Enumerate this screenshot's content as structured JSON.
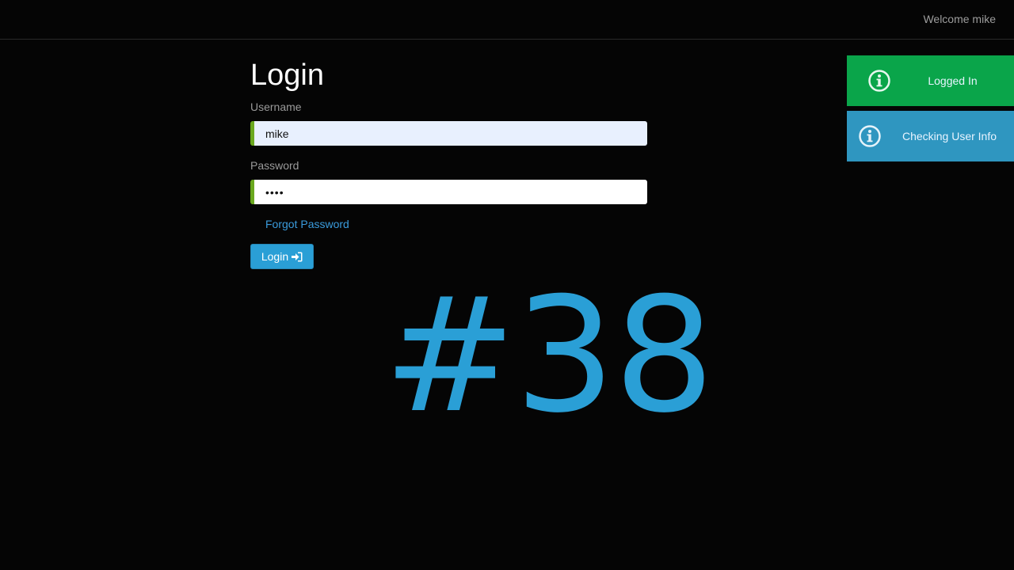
{
  "navbar": {
    "welcome_text": "Welcome mike"
  },
  "login_form": {
    "title": "Login",
    "username_label": "Username",
    "username_value": "mike",
    "password_label": "Password",
    "password_value": "••••",
    "forgot_password_link": "Forgot Password",
    "login_button_label": "Login"
  },
  "overlay": {
    "episode_number": "#38"
  },
  "toasts": [
    {
      "type": "success",
      "message": "Logged In",
      "icon": "info-circle-icon"
    },
    {
      "type": "info",
      "message": "Checking User Info",
      "icon": "info-circle-icon"
    }
  ],
  "colors": {
    "accent": "#2a9fd6",
    "success": "#0aa54a",
    "info": "#2f96c0",
    "input_border": "#6aa81e"
  }
}
